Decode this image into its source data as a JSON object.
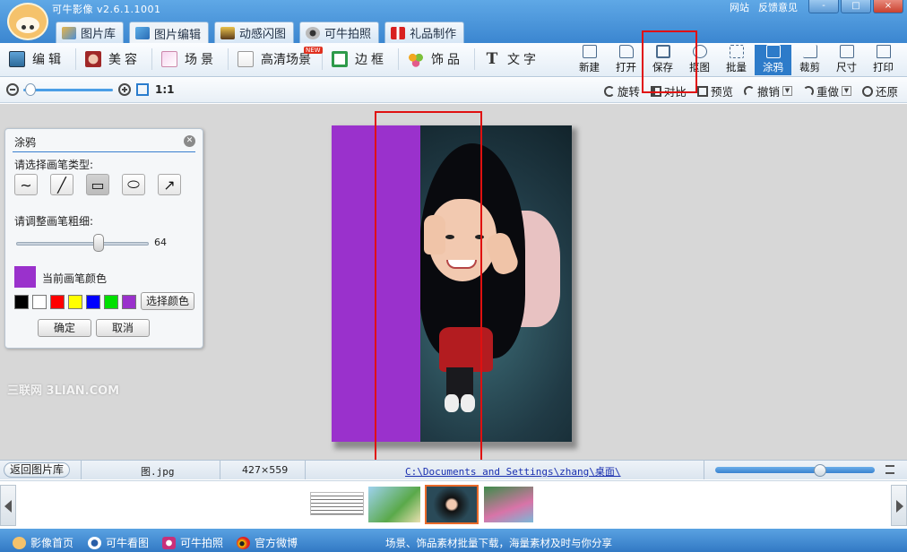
{
  "app": {
    "title": "可牛影像 v2.6.1.1001",
    "links": [
      "网站",
      "反馈意见"
    ],
    "window_buttons": [
      "-",
      "□",
      "×"
    ]
  },
  "tabs": [
    {
      "label": "图片库",
      "icon": "photo-library-icon"
    },
    {
      "label": "图片编辑",
      "icon": "photo-edit-icon",
      "active": true
    },
    {
      "label": "动感闪图",
      "icon": "flash-animation-icon"
    },
    {
      "label": "可牛拍照",
      "icon": "camera-icon"
    },
    {
      "label": "礼品制作",
      "icon": "gift-icon"
    }
  ],
  "toolbar_left": [
    {
      "label": "编辑",
      "icon": "edit-icon"
    },
    {
      "label": "美容",
      "icon": "beauty-icon"
    },
    {
      "label": "场景",
      "icon": "scene-icon"
    },
    {
      "label": "高清场景",
      "icon": "hd-scene-icon",
      "badge": "NEW"
    },
    {
      "label": "边框",
      "icon": "frame-icon"
    },
    {
      "label": "饰品",
      "icon": "accessory-icon"
    },
    {
      "label": "文字",
      "icon": "text-icon"
    }
  ],
  "toolbar_right": [
    {
      "label": "新建",
      "icon": "new-file-icon"
    },
    {
      "label": "打开",
      "icon": "open-folder-icon"
    },
    {
      "label": "保存",
      "icon": "save-icon"
    },
    {
      "label": "抠图",
      "icon": "cutout-icon"
    },
    {
      "label": "批量",
      "icon": "batch-icon"
    },
    {
      "label": "涂鸦",
      "icon": "doodle-icon",
      "active": true
    },
    {
      "label": "裁剪",
      "icon": "crop-icon"
    },
    {
      "label": "尺寸",
      "icon": "resize-icon"
    },
    {
      "label": "打印",
      "icon": "print-icon"
    }
  ],
  "subbar": {
    "ratio": "1:1",
    "rotate": "旋转",
    "compare": "对比",
    "preview": "预览",
    "undo": "撤销",
    "redo": "重做",
    "restore": "还原"
  },
  "doodle_panel": {
    "title": "涂鸦",
    "brush_type_label": "请选择画笔类型:",
    "brush_types": [
      {
        "name": "freehand",
        "glyph": "∼"
      },
      {
        "name": "line",
        "glyph": "╱"
      },
      {
        "name": "rectangle",
        "glyph": "▭",
        "selected": true
      },
      {
        "name": "ellipse",
        "glyph": "⬭"
      },
      {
        "name": "arrow",
        "glyph": "↗"
      }
    ],
    "thickness_label": "请调整画笔粗细:",
    "thickness_value": "64",
    "current_color_label": "当前画笔颜色",
    "current_color": "#9a31cc",
    "palette": [
      "#000000",
      "#ffffff",
      "#ff0000",
      "#ffff00",
      "#0000ff",
      "#00e000",
      "#9a31cc"
    ],
    "pick_color_label": "选择颜色",
    "confirm_label": "确定",
    "cancel_label": "取消"
  },
  "watermark": "三联网 3LIAN.COM",
  "status": {
    "back_label": "返回图片库",
    "filename": "图.jpg",
    "dimensions": "427×559",
    "path": "C:\\Documents and Settings\\zhang\\桌面\\"
  },
  "bottombar": {
    "items": [
      {
        "label": "影像首页",
        "icon": "home-cow-icon"
      },
      {
        "label": "可牛看图",
        "icon": "viewer-eye-icon"
      },
      {
        "label": "可牛拍照",
        "icon": "camera-icon"
      },
      {
        "label": "官方微博",
        "icon": "weibo-icon"
      }
    ],
    "slogan": "场景、饰品素材批量下载，海量素材及时与你分享"
  },
  "colors": {
    "titlebar": "#3b86d0",
    "highlight_box": "#e01010",
    "doodle_purple": "#9a31cc"
  }
}
